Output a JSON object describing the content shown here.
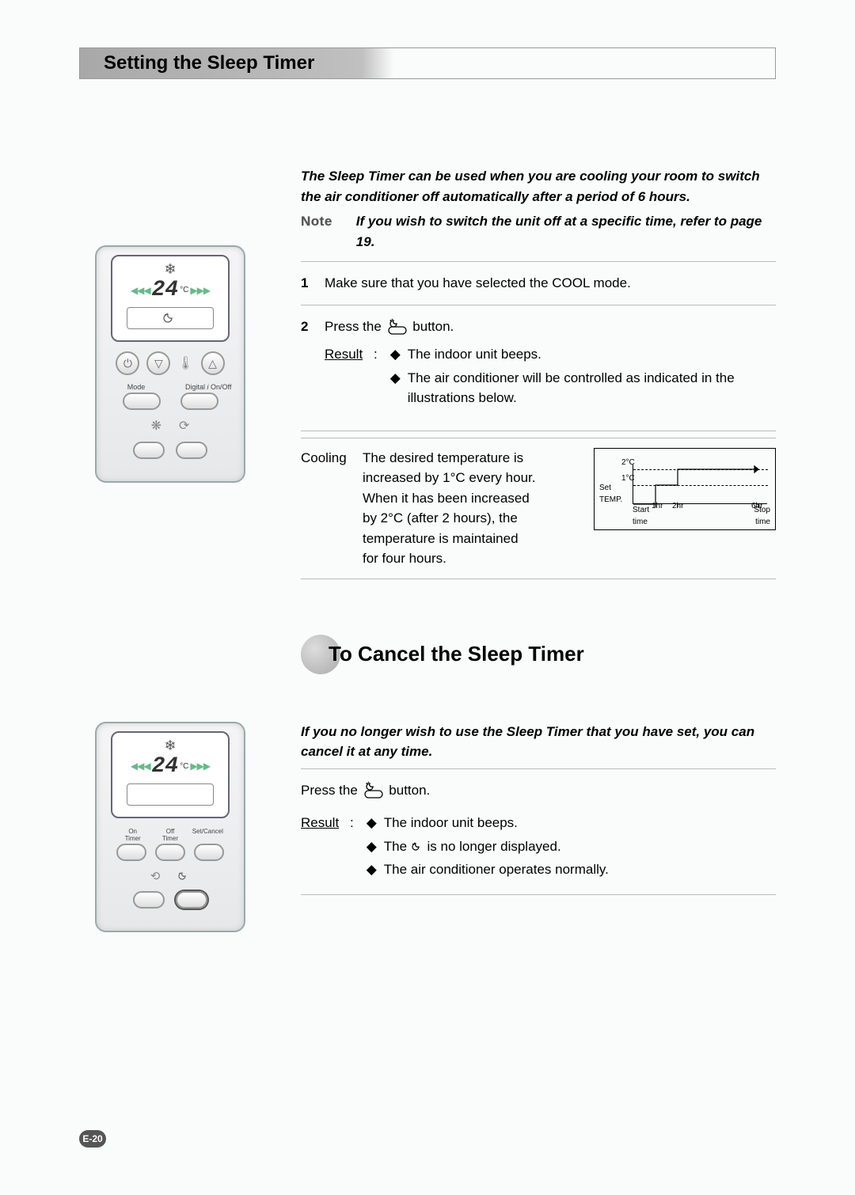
{
  "page": {
    "title": "Setting the Sleep Timer",
    "number": "E-20"
  },
  "intro": {
    "text": "The Sleep Timer can be used when you are cooling your room to switch the air conditioner off automatically after a period of 6 hours.",
    "note_label": "Note",
    "note_text": "If you wish to switch the unit off at a specific time, refer to page 19."
  },
  "steps": [
    {
      "num": "1",
      "text": "Make sure that you have selected the COOL mode."
    },
    {
      "num": "2",
      "text_before": "Press the",
      "text_after": "button."
    }
  ],
  "step2_result": {
    "label": "Result",
    "bullets": [
      "The indoor unit beeps.",
      "The air conditioner will be controlled as indicated in the illustrations below."
    ]
  },
  "cooling": {
    "label": "Cooling",
    "text": "The desired temperature is increased by 1°C every hour. When it has been increased by 2°C (after 2 hours), the temperature is maintained for four hours."
  },
  "chart_data": {
    "type": "line",
    "xlabel_left": "Start\ntime",
    "xlabel_right": "Stop\ntime",
    "ylabel": "Set\nTEMP.",
    "x_ticks": [
      "1hr",
      "2hr",
      "6hr"
    ],
    "y_levels": [
      "1°C",
      "2°C"
    ],
    "series": [
      {
        "name": "temp_increase",
        "x": [
          0,
          1,
          1,
          2,
          2,
          6
        ],
        "y": [
          0,
          0,
          1,
          1,
          2,
          2
        ]
      }
    ],
    "annotations": {
      "arrow_end": true
    }
  },
  "cancel": {
    "title": "To Cancel the Sleep Timer",
    "intro": "If you no longer wish to use the Sleep Timer that you have set, you can cancel it at any time.",
    "press_before": "Press the",
    "press_after": "button.",
    "result_label": "Result",
    "bullets_pre": "The indoor unit beeps.",
    "bullet2_before": "The",
    "bullet2_after": "is no longer displayed.",
    "bullet3": "The air conditioner operates normally."
  },
  "remote": {
    "temp": "24",
    "unit": "°C",
    "mode_label": "Mode",
    "onoff_label": "On/Off",
    "digital_label": "Digital",
    "on_timer": "On\nTimer",
    "off_timer": "Off\nTimer",
    "setcancel": "Set/Cancel"
  }
}
